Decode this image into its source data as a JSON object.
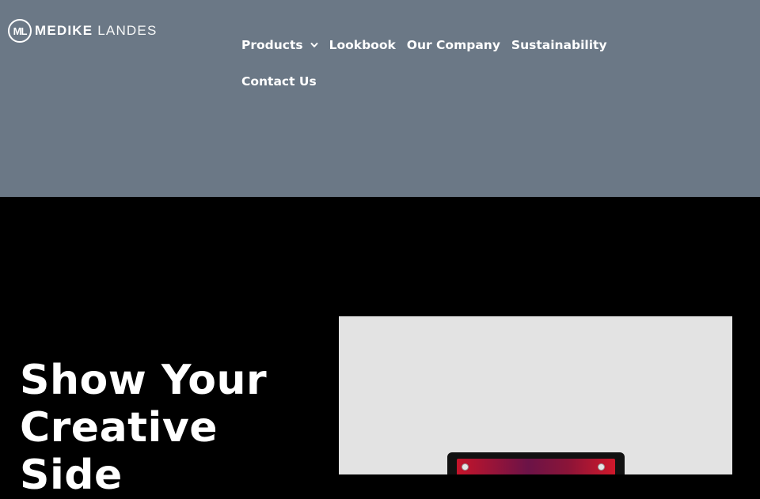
{
  "brand": {
    "mark": "ML",
    "name_bold": "MEDIKE",
    "name_light": "LANDES"
  },
  "nav": {
    "items": [
      {
        "label": "Products",
        "has_dropdown": true
      },
      {
        "label": "Lookbook"
      },
      {
        "label": "Our Company"
      },
      {
        "label": "Sustainability"
      },
      {
        "label": "Contact Us"
      }
    ]
  },
  "hero": {
    "title": "Show Your Creative Side"
  },
  "colors": {
    "header_bg": "#6b7886",
    "hero_bg": "#000000",
    "text": "#ffffff",
    "image_bg": "#e3e3e3"
  }
}
